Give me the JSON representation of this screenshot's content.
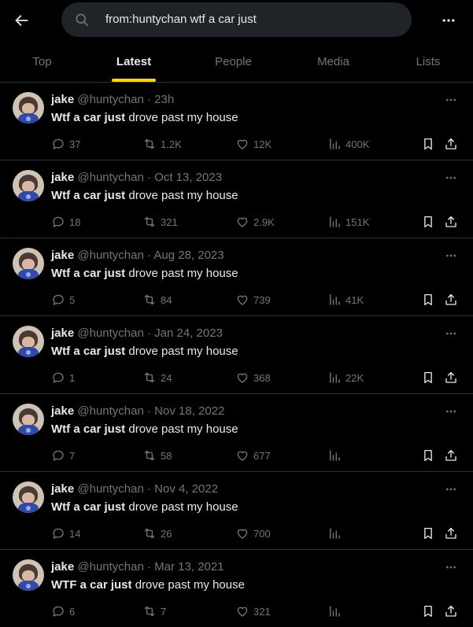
{
  "header": {
    "back_icon": "arrow-left-icon",
    "search_icon": "search-icon",
    "query": "from:huntychan wtf a car just",
    "more_icon": "more-horizontal-icon"
  },
  "tabs": [
    {
      "label": "Top",
      "active": false
    },
    {
      "label": "Latest",
      "active": true
    },
    {
      "label": "People",
      "active": false
    },
    {
      "label": "Media",
      "active": false
    },
    {
      "label": "Lists",
      "active": false
    }
  ],
  "colors": {
    "background": "#000000",
    "text": "#e7e9ea",
    "muted": "#71767b",
    "border": "#2f3336",
    "active_tab_indicator": "#ffd400",
    "search_bg": "#202327"
  },
  "tweets": [
    {
      "name": "jake",
      "handle": "@huntychan",
      "sep": "·",
      "time": "23h",
      "bold": "Wtf a car just",
      "rest": " drove past my house",
      "replies": "37",
      "retweets": "1.2K",
      "likes": "12K",
      "views": "400K"
    },
    {
      "name": "jake",
      "handle": "@huntychan",
      "sep": "·",
      "time": "Oct 13, 2023",
      "bold": "Wtf a car just",
      "rest": " drove past my house",
      "replies": "18",
      "retweets": "321",
      "likes": "2.9K",
      "views": "151K"
    },
    {
      "name": "jake",
      "handle": "@huntychan",
      "sep": "·",
      "time": "Aug 28, 2023",
      "bold": "Wtf a car just",
      "rest": " drove past my house",
      "replies": "5",
      "retweets": "84",
      "likes": "739",
      "views": "41K"
    },
    {
      "name": "jake",
      "handle": "@huntychan",
      "sep": "·",
      "time": "Jan 24, 2023",
      "bold": "Wtf a car just",
      "rest": " drove past my house",
      "replies": "1",
      "retweets": "24",
      "likes": "368",
      "views": "22K"
    },
    {
      "name": "jake",
      "handle": "@huntychan",
      "sep": "·",
      "time": "Nov 18, 2022",
      "bold": "Wtf a car just",
      "rest": " drove past my house",
      "replies": "7",
      "retweets": "58",
      "likes": "677",
      "views": ""
    },
    {
      "name": "jake",
      "handle": "@huntychan",
      "sep": "·",
      "time": "Nov 4, 2022",
      "bold": "Wtf a car just",
      "rest": " drove past my house",
      "replies": "14",
      "retweets": "26",
      "likes": "700",
      "views": ""
    },
    {
      "name": "jake",
      "handle": "@huntychan",
      "sep": "·",
      "time": "Mar 13, 2021",
      "bold": "WTF a car just",
      "rest": " drove past my house",
      "replies": "6",
      "retweets": "7",
      "likes": "321",
      "views": ""
    }
  ]
}
